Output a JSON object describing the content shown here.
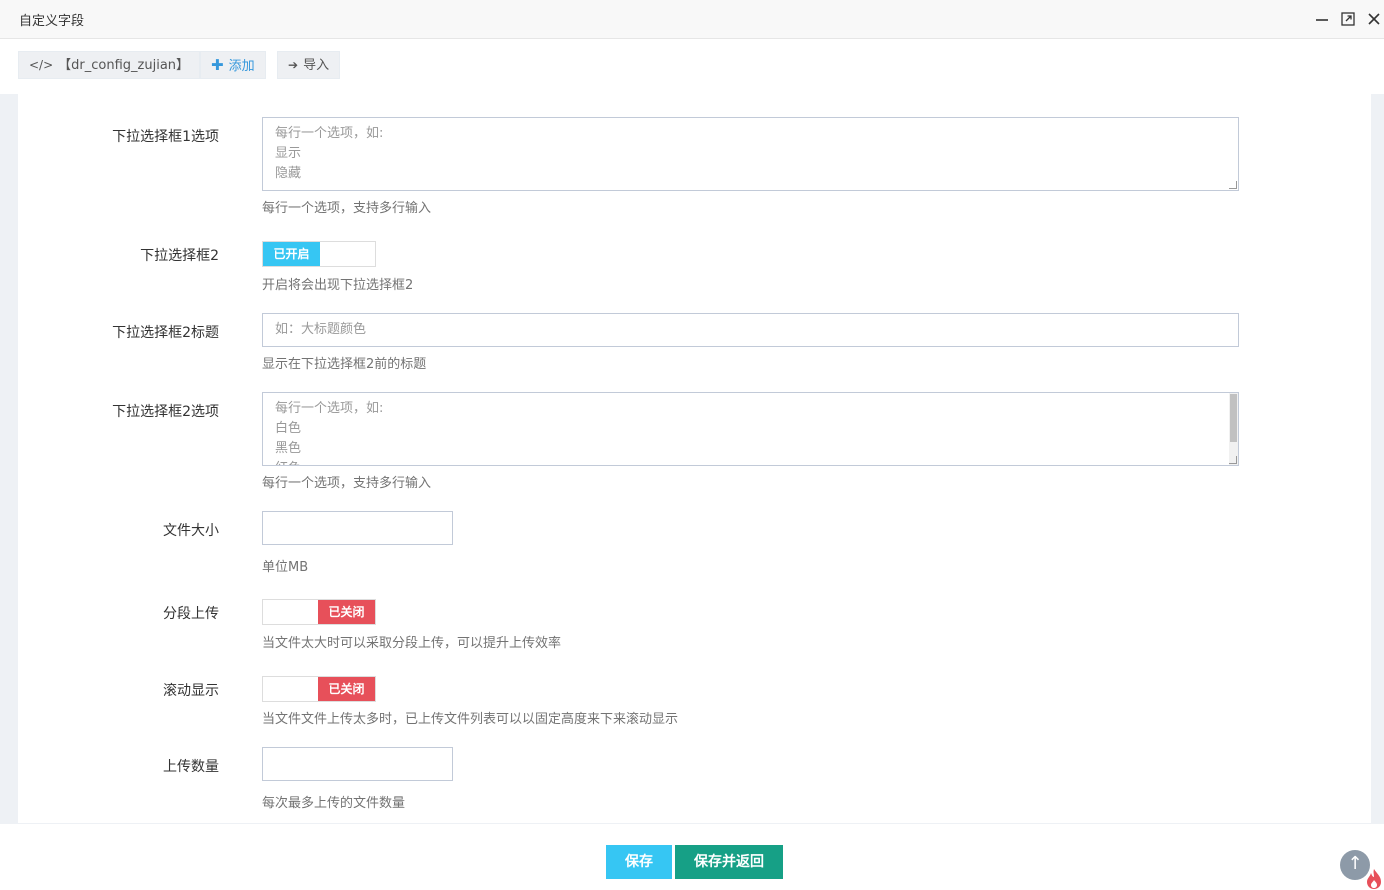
{
  "window": {
    "title": "自定义字段",
    "minimize_label": "—",
    "maximize_label": "⤢",
    "close_label": "✕"
  },
  "toolbar": {
    "code_icon_label": "</>",
    "code_label": "【dr_config_zujian】",
    "add_label": "添加",
    "import_label": "导入"
  },
  "form": {
    "select1_options": {
      "label": "下拉选择框1选项",
      "placeholder_lines": [
        "每行一个选项，如:",
        "显示",
        "隐藏"
      ],
      "help": "每行一个选项，支持多行输入"
    },
    "select2": {
      "label": "下拉选择框2",
      "state_label": "已开启",
      "help": "开启将会出现下拉选择框2"
    },
    "select2_title": {
      "label": "下拉选择框2标题",
      "placeholder": "如：大标题颜色",
      "help": "显示在下拉选择框2前的标题"
    },
    "select2_options": {
      "label": "下拉选择框2选项",
      "placeholder_lines": [
        "每行一个选项，如:",
        "白色",
        "黑色",
        "红色"
      ],
      "help": "每行一个选项，支持多行输入"
    },
    "file_size": {
      "label": "文件大小",
      "value": "",
      "help": "单位MB"
    },
    "chunk_upload": {
      "label": "分段上传",
      "state_label": "已关闭",
      "help": "当文件太大时可以采取分段上传，可以提升上传效率"
    },
    "scroll_display": {
      "label": "滚动显示",
      "state_label": "已关闭",
      "help": "当文件文件上传太多时，已上传文件列表可以以固定高度来下来滚动显示"
    },
    "upload_count": {
      "label": "上传数量",
      "value": "",
      "help": "每次最多上传的文件数量"
    }
  },
  "footer": {
    "save_label": "保存",
    "save_back_label": "保存并返回",
    "to_top_label": "↑"
  },
  "colors": {
    "switch_on": "#36c6f3",
    "switch_off": "#e7505a",
    "save_button": "#36c6f3",
    "save_back_button": "#16a086",
    "add_accent": "#3598dc"
  }
}
